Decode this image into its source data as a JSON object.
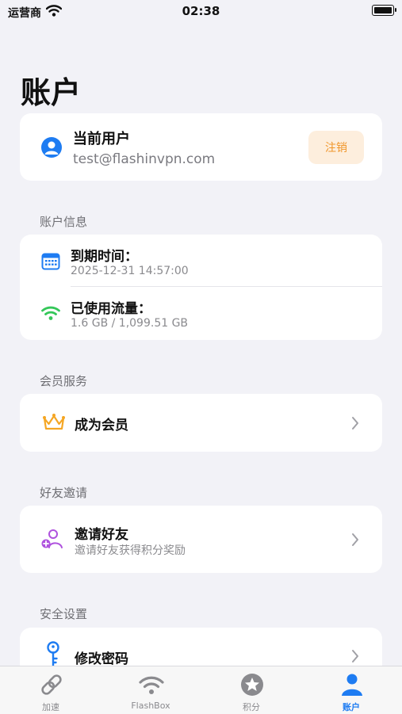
{
  "status_bar": {
    "carrier": "运营商",
    "time": "02:38"
  },
  "page_title": "账户",
  "user_card": {
    "title": "当前用户",
    "email": "test@flashinvpn.com",
    "logout_label": "注销"
  },
  "account_info": {
    "section_label": "账户信息",
    "expiry": {
      "label": "到期时间：",
      "value": "2025-12-31 14:57:00"
    },
    "traffic": {
      "label": "已使用流量：",
      "value": "1.6 GB / 1,099.51 GB"
    }
  },
  "membership": {
    "section_label": "会员服务",
    "item_label": "成为会员"
  },
  "invite": {
    "section_label": "好友邀请",
    "item_label": "邀请好友",
    "item_sub": "邀请好友获得积分奖励"
  },
  "security": {
    "section_label": "安全设置",
    "item_label": "修改密码"
  },
  "tab_bar": {
    "tabs": [
      {
        "label": "加速",
        "icon": "link-icon"
      },
      {
        "label": "FlashBox",
        "icon": "wifi-icon"
      },
      {
        "label": "积分",
        "icon": "star-icon"
      },
      {
        "label": "账户",
        "icon": "person-icon"
      }
    ],
    "active_index": 3
  },
  "colors": {
    "accent": "#1e7cf2",
    "logout_bg": "#fdeedd",
    "logout_text": "#f0962a",
    "background": "#f2f2f7"
  }
}
